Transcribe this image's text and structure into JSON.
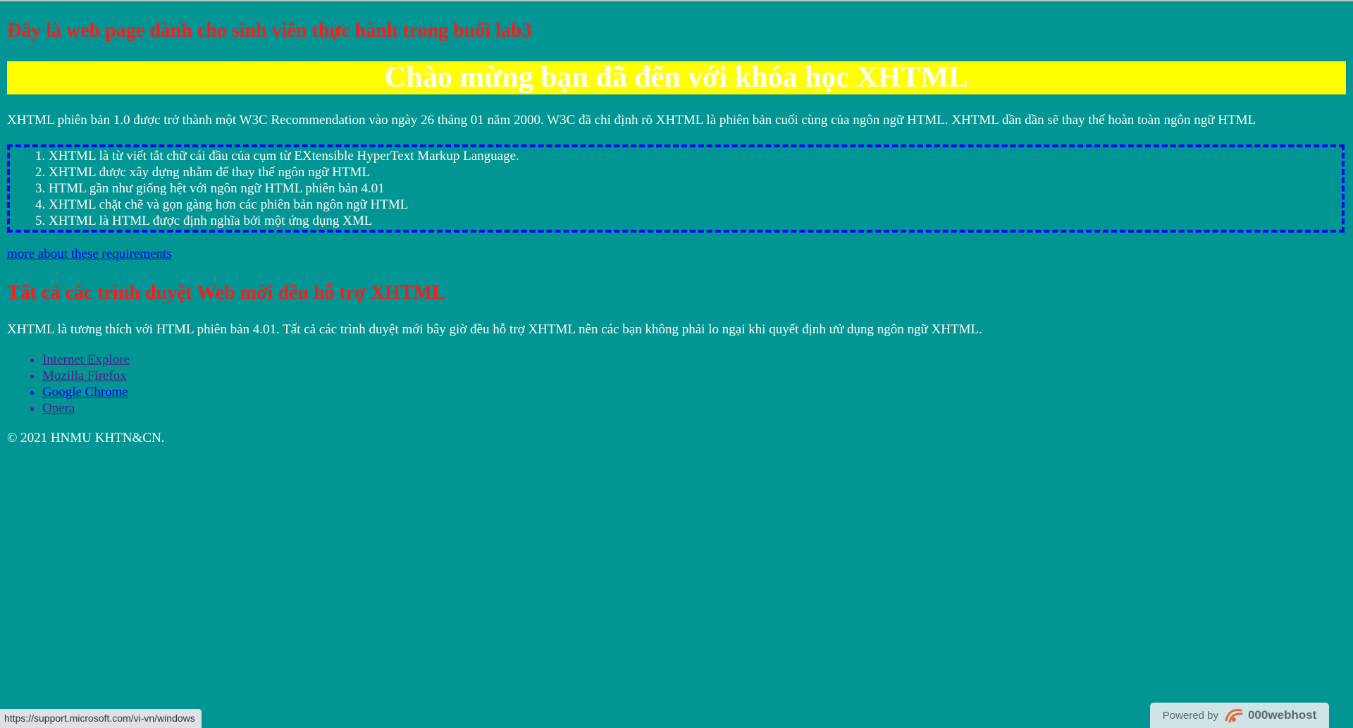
{
  "page": {
    "lab_title": "Đây là web page dành cho sinh viên thực hành trong buổi lab3",
    "banner_heading": "Chào mừng bạn đã đến với khóa học XHTML",
    "intro_paragraph": "XHTML phiên bản 1.0 được trở thành một W3C Recommendation vào ngày 26 tháng 01 năm 2000. W3C đã chỉ định rõ XHTML là phiên bản cuối cùng của ngôn ngữ HTML. XHTML dần dần sẽ thay thế hoàn toàn ngôn ngữ HTML",
    "requirements": [
      "XHTML là từ viết tắt chữ cái đầu của cụm từ EXtensible HyperText Markup Language.",
      "XHTML được xây dựng nhằm để thay thế ngôn ngữ HTML",
      "HTML gần như giống hệt với ngôn ngữ HTML phiên bản 4.01",
      "XHTML chặt chẽ và gọn gàng hơn các phiên bản ngôn ngữ HTML",
      "XHTML là HTML được định nghĩa bởi một ứng dụng XML"
    ],
    "more_link": "more about these requirements",
    "support_heading": "Tất cả các trình duyệt Web mới đều hỗ trợ XHTML",
    "compat_paragraph": "XHTML là tương thích với HTML phiên bản 4.01. Tất cả các trình duyệt mới bây giờ đều hỗ trợ XHTML nên các bạn không phải lo ngại khi quyết định ưử dụng ngôn ngữ XHTML.",
    "browsers": [
      "Internet Explore",
      "Mozilla Firefox",
      "Google Chrome",
      "Opera"
    ],
    "copyright": "© 2021 HNMU KHTN&CN."
  },
  "status_bar": {
    "url": "https://support.microsoft.com/vi-vn/windows"
  },
  "badge": {
    "powered_by": "Powered by",
    "brand": "000webhost"
  },
  "colors": {
    "background": "#019593",
    "heading_red": "#ff1a1a",
    "banner_yellow": "#ffff00",
    "dashed_border": "#0000ff",
    "link_blue": "#0000ee",
    "visited_purple": "#551a8b"
  }
}
